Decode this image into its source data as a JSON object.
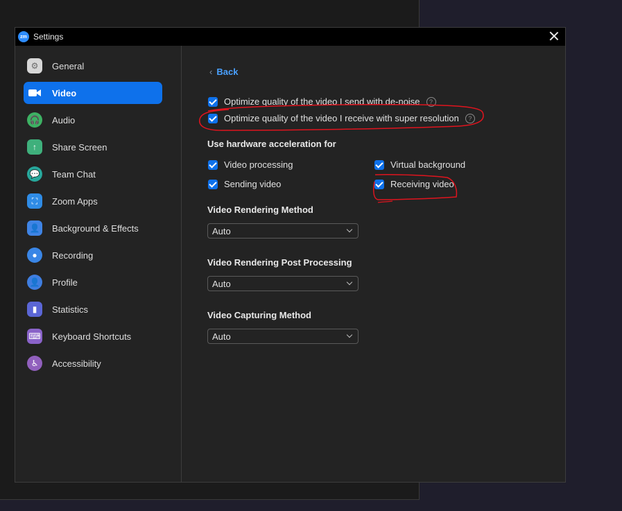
{
  "window": {
    "title": "Settings",
    "logo_text": "zm"
  },
  "sidebar": {
    "items": [
      {
        "label": "General",
        "icon": "gear-icon",
        "color": "#d7d7d7"
      },
      {
        "label": "Video",
        "icon": "video-camera-icon",
        "color": "#ffffff"
      },
      {
        "label": "Audio",
        "icon": "headphones-icon",
        "color": "#3db163"
      },
      {
        "label": "Share Screen",
        "icon": "share-screen-icon",
        "color": "#3fb07c"
      },
      {
        "label": "Team Chat",
        "icon": "chat-icon",
        "color": "#27a79b"
      },
      {
        "label": "Zoom Apps",
        "icon": "apps-icon",
        "color": "#2f8ce6"
      },
      {
        "label": "Background & Effects",
        "icon": "person-background-icon",
        "color": "#3f84e5"
      },
      {
        "label": "Recording",
        "icon": "record-icon",
        "color": "#3a86e6"
      },
      {
        "label": "Profile",
        "icon": "profile-icon",
        "color": "#3f7ee0"
      },
      {
        "label": "Statistics",
        "icon": "statistics-icon",
        "color": "#5b66d6"
      },
      {
        "label": "Keyboard Shortcuts",
        "icon": "keyboard-icon",
        "color": "#8a63c9"
      },
      {
        "label": "Accessibility",
        "icon": "accessibility-icon",
        "color": "#9160bd"
      }
    ],
    "active_index": 1
  },
  "content": {
    "back_label": "Back",
    "options": {
      "denoise": "Optimize quality of the video I send with de-noise",
      "super_resolution": "Optimize quality of the video I receive with super resolution"
    },
    "hw_heading": "Use hardware acceleration for",
    "hw": {
      "video_processing": "Video processing",
      "sending_video": "Sending video",
      "virtual_background": "Virtual background",
      "receiving_video": "Receiving video"
    },
    "rendering_method": {
      "label": "Video Rendering Method",
      "value": "Auto"
    },
    "post_processing": {
      "label": "Video Rendering Post Processing",
      "value": "Auto"
    },
    "capturing_method": {
      "label": "Video Capturing Method",
      "value": "Auto"
    }
  },
  "colors": {
    "accent": "#0e71eb",
    "link": "#4aa1ff",
    "annotation": "#e0141e"
  }
}
